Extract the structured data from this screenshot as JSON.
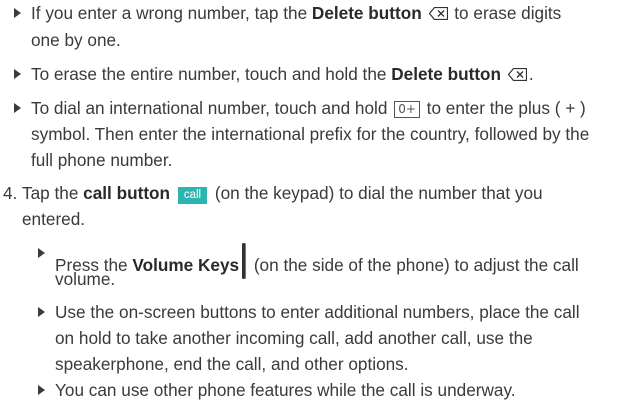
{
  "bullets": [
    {
      "lines": [
        {
          "parts": [
            "If you enter a wrong number, tap the ",
            "Delete button",
            " to erase digits"
          ]
        },
        {
          "parts": [
            "one by one."
          ]
        }
      ]
    },
    {
      "lines": [
        {
          "parts": [
            "To erase the entire number, touch and hold the ",
            "Delete button",
            "."
          ]
        }
      ]
    },
    {
      "lines": [
        {
          "parts": [
            "To dial an international number, touch and hold ",
            "0+",
            " to enter the plus ( + )"
          ]
        },
        {
          "parts": [
            "symbol. Then enter the international prefix for the country, followed by the"
          ]
        },
        {
          "parts": [
            "full phone number."
          ]
        }
      ]
    }
  ],
  "step4": {
    "number": "4.",
    "text_a": "Tap the ",
    "bold": "call button",
    "call_label": "call",
    "text_b": " (on the keypad) to dial the number that you",
    "text_c": "entered."
  },
  "sub_bullets": [
    {
      "pre": "Press the ",
      "bold": "Volume Keys",
      "post": " (on the side of the phone) to adjust the call",
      "line2": "volume."
    },
    {
      "line1": "Use the on-screen buttons to enter additional numbers, place the call",
      "line2": "on hold to take another incoming call, add another call, use the",
      "line3": "speakerphone, end the call, and other options."
    },
    {
      "line1": "You can use other phone features while the call is underway."
    }
  ],
  "icons": {
    "delete": "delete-key-icon",
    "zero": "zero-plus-key-icon",
    "volume": "volume-keys-icon",
    "bullet": "triangle-bullet-icon"
  }
}
